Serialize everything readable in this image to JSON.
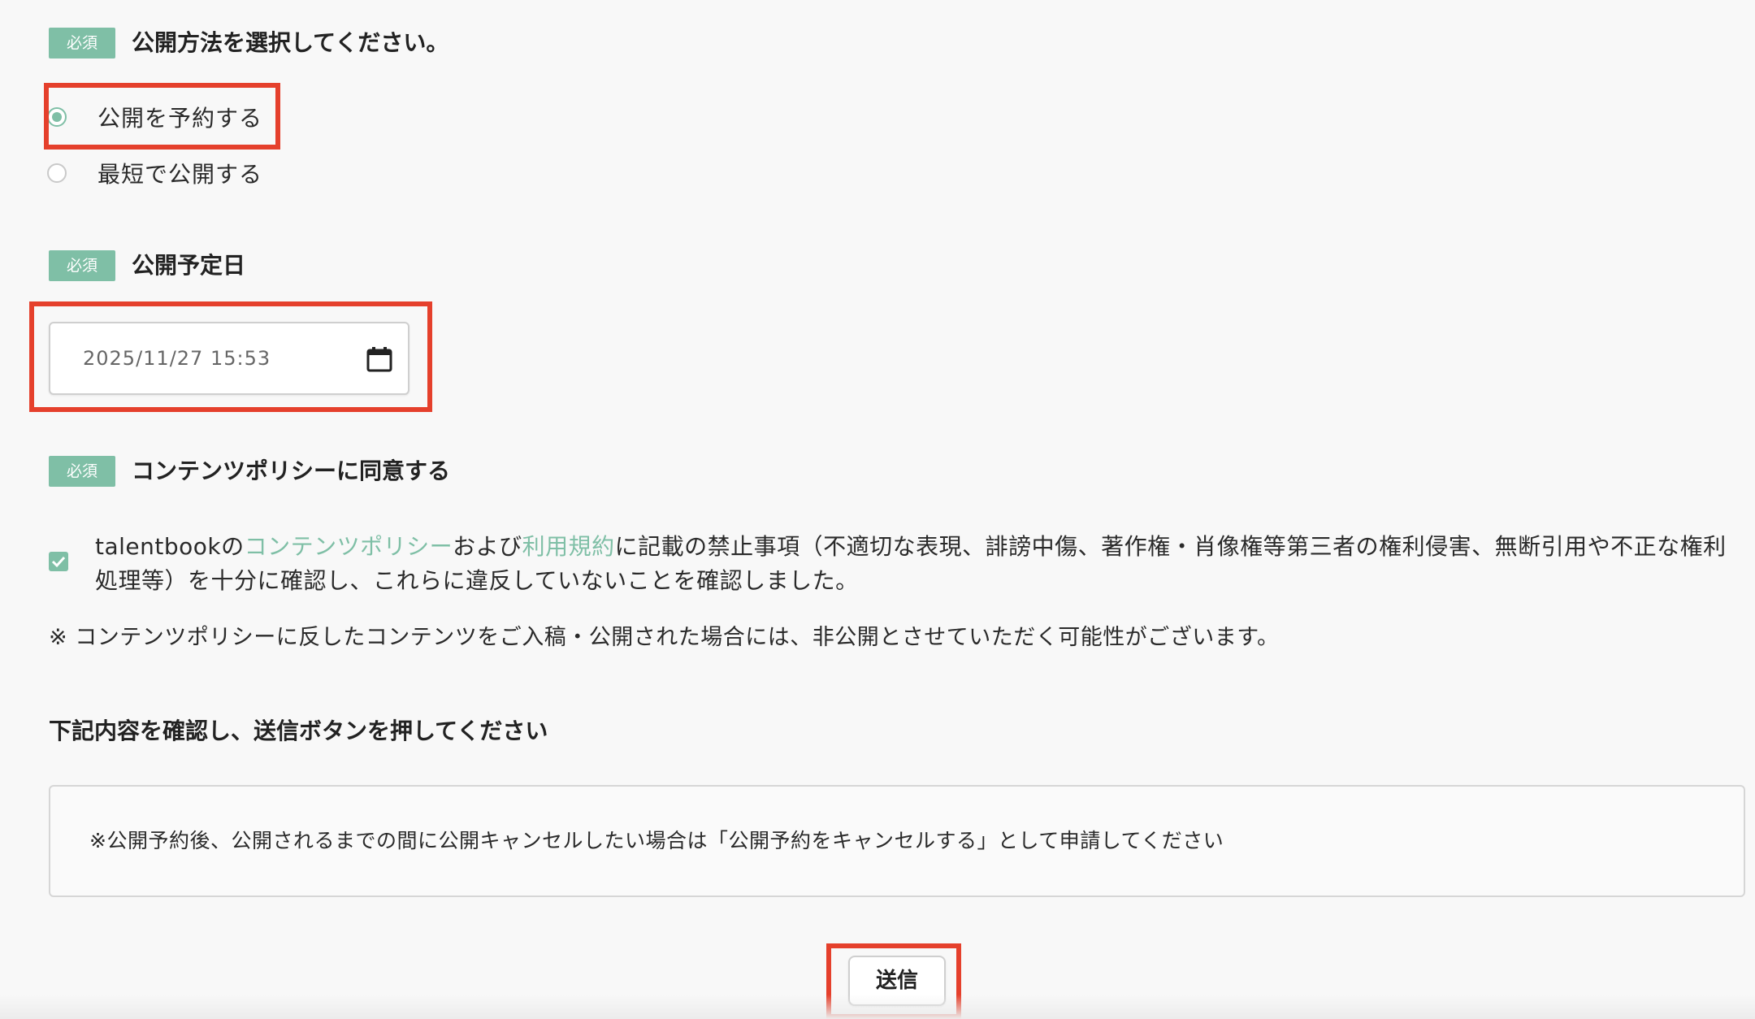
{
  "sections": {
    "publish_method": {
      "badge": "必須",
      "title": "公開方法を選択してください。",
      "options": [
        {
          "label": "公開を予約する",
          "selected": true
        },
        {
          "label": "最短で公開する",
          "selected": false
        }
      ]
    },
    "publish_date": {
      "badge": "必須",
      "title": "公開予定日",
      "value": "2025/11/27 15:53",
      "icon": "calendar-icon"
    },
    "content_policy": {
      "badge": "必須",
      "title": "コンテンツポリシーに同意する",
      "checked": true,
      "consent_prefix": "talentbookの",
      "policy_link": "コンテンツポリシー",
      "and_text": "および",
      "terms_link": "利用規約",
      "consent_suffix": "に記載の禁止事項（不適切な表現、誹謗中傷、著作権・肖像権等第三者の権利侵害、無断引用や不正な権利処理等）を十分に確認し、これらに違反していないことを確認しました。",
      "notice": "※ コンテンツポリシーに反したコンテンツをご入稿・公開された場合には、非公開とさせていただく可能性がございます。"
    },
    "confirmation": {
      "title": "下記内容を確認し、送信ボタンを押してください",
      "message": "※公開予約後、公開されるまでの間に公開キャンセルしたい場合は「公開予約をキャンセルする」として申請してください"
    }
  },
  "submit_label": "送信",
  "colors": {
    "accent": "#7fbfa6",
    "highlight": "#e5402c",
    "background": "#f8f8f8"
  }
}
